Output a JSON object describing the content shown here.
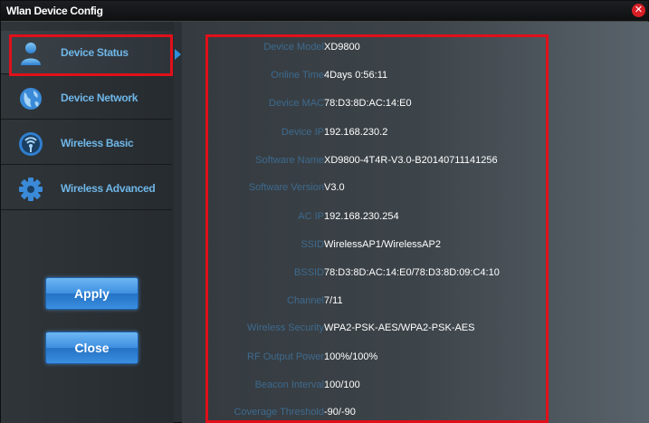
{
  "window": {
    "title": "Wlan Device Config"
  },
  "sidebar": {
    "items": [
      {
        "label": "Device Status",
        "icon": "person-icon"
      },
      {
        "label": "Device Network",
        "icon": "globe-icon"
      },
      {
        "label": "Wireless Basic",
        "icon": "wireless-icon"
      },
      {
        "label": "Wireless Advanced",
        "icon": "gear-icon"
      }
    ],
    "apply_label": "Apply",
    "close_label": "Close"
  },
  "status": {
    "rows": [
      {
        "label": "Device Model",
        "value": "XD9800"
      },
      {
        "label": "Online Time",
        "value": "4Days 0:56:11"
      },
      {
        "label": "Device MAC",
        "value": "78:D3:8D:AC:14:E0"
      },
      {
        "label": "Device IP",
        "value": "192.168.230.2"
      },
      {
        "label": "Software Name",
        "value": "XD9800-4T4R-V3.0-B20140711141256"
      },
      {
        "label": "Software Version",
        "value": "V3.0"
      },
      {
        "label": "AC IP",
        "value": "192.168.230.254"
      },
      {
        "label": "SSID",
        "value": "WirelessAP1/WirelessAP2"
      },
      {
        "label": "BSSID",
        "value": "78:D3:8D:AC:14:E0/78:D3:8D:09:C4:10"
      },
      {
        "label": "Channel",
        "value": "7/11"
      },
      {
        "label": "Wireless Security",
        "value": "WPA2-PSK-AES/WPA2-PSK-AES"
      },
      {
        "label": "RF Output Power",
        "value": "100%/100%"
      },
      {
        "label": "Beacon Interval",
        "value": "100/100"
      },
      {
        "label": "Coverage Threshold",
        "value": "-90/-90"
      }
    ]
  },
  "colors": {
    "accent": "#2f8fdb",
    "highlight_border": "#e0101a",
    "label_text": "#3d6a8f",
    "nav_text": "#6fb6e8"
  }
}
